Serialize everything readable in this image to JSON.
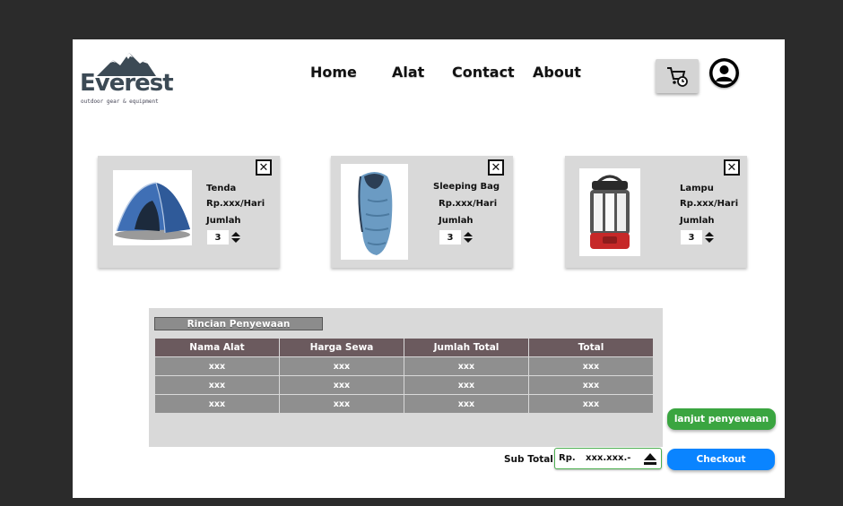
{
  "logo": {
    "wordmark": "Everest",
    "tagline": "outdoor gear & equipment"
  },
  "nav": {
    "home": "Home",
    "alat": "Alat",
    "contact": "Contact",
    "about": "About"
  },
  "icons": {
    "cart": "cart-icon",
    "user": "user-icon",
    "close": "close-icon"
  },
  "cart_items": [
    {
      "name": "Tenda",
      "price": "Rp.xxx/Hari",
      "qty_label": "Jumlah",
      "qty": "3",
      "image": "tent"
    },
    {
      "name": "Sleeping Bag",
      "price": "Rp.xxx/Hari",
      "qty_label": "Jumlah",
      "qty": "3",
      "image": "sleeping-bag"
    },
    {
      "name": "Lampu",
      "price": "Rp.xxx/Hari",
      "qty_label": "Jumlah",
      "qty": "3",
      "image": "lantern"
    }
  ],
  "summary": {
    "title": "Rincian Penyewaan",
    "columns": [
      "Nama Alat",
      "Harga Sewa",
      "Jumlah Total",
      "Total"
    ],
    "rows": [
      [
        "xxx",
        "xxx",
        "xxx",
        "xxx"
      ],
      [
        "xxx",
        "xxx",
        "xxx",
        "xxx"
      ],
      [
        "xxx",
        "xxx",
        "xxx",
        "xxx"
      ]
    ]
  },
  "subtotal": {
    "label": "Sub Total",
    "currency": "Rp.",
    "value": "xxx.xxx.-"
  },
  "buttons": {
    "continue": "lanjut penyewaan",
    "checkout": "Checkout"
  },
  "colors": {
    "continue": "#3aa540",
    "checkout": "#0a84ff",
    "table_header": "#6b5a5e",
    "card_bg": "#d9d9d9"
  }
}
